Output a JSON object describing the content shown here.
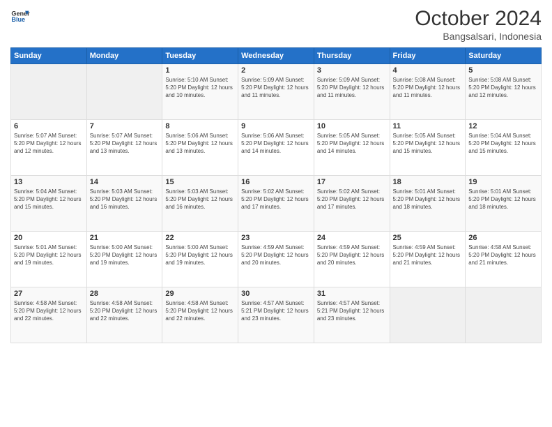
{
  "header": {
    "logo_line1": "General",
    "logo_line2": "Blue",
    "month": "October 2024",
    "location": "Bangsalsari, Indonesia"
  },
  "days_of_week": [
    "Sunday",
    "Monday",
    "Tuesday",
    "Wednesday",
    "Thursday",
    "Friday",
    "Saturday"
  ],
  "weeks": [
    [
      {
        "day": "",
        "info": ""
      },
      {
        "day": "",
        "info": ""
      },
      {
        "day": "1",
        "info": "Sunrise: 5:10 AM\nSunset: 5:20 PM\nDaylight: 12 hours\nand 10 minutes."
      },
      {
        "day": "2",
        "info": "Sunrise: 5:09 AM\nSunset: 5:20 PM\nDaylight: 12 hours\nand 11 minutes."
      },
      {
        "day": "3",
        "info": "Sunrise: 5:09 AM\nSunset: 5:20 PM\nDaylight: 12 hours\nand 11 minutes."
      },
      {
        "day": "4",
        "info": "Sunrise: 5:08 AM\nSunset: 5:20 PM\nDaylight: 12 hours\nand 11 minutes."
      },
      {
        "day": "5",
        "info": "Sunrise: 5:08 AM\nSunset: 5:20 PM\nDaylight: 12 hours\nand 12 minutes."
      }
    ],
    [
      {
        "day": "6",
        "info": "Sunrise: 5:07 AM\nSunset: 5:20 PM\nDaylight: 12 hours\nand 12 minutes."
      },
      {
        "day": "7",
        "info": "Sunrise: 5:07 AM\nSunset: 5:20 PM\nDaylight: 12 hours\nand 13 minutes."
      },
      {
        "day": "8",
        "info": "Sunrise: 5:06 AM\nSunset: 5:20 PM\nDaylight: 12 hours\nand 13 minutes."
      },
      {
        "day": "9",
        "info": "Sunrise: 5:06 AM\nSunset: 5:20 PM\nDaylight: 12 hours\nand 14 minutes."
      },
      {
        "day": "10",
        "info": "Sunrise: 5:05 AM\nSunset: 5:20 PM\nDaylight: 12 hours\nand 14 minutes."
      },
      {
        "day": "11",
        "info": "Sunrise: 5:05 AM\nSunset: 5:20 PM\nDaylight: 12 hours\nand 15 minutes."
      },
      {
        "day": "12",
        "info": "Sunrise: 5:04 AM\nSunset: 5:20 PM\nDaylight: 12 hours\nand 15 minutes."
      }
    ],
    [
      {
        "day": "13",
        "info": "Sunrise: 5:04 AM\nSunset: 5:20 PM\nDaylight: 12 hours\nand 15 minutes."
      },
      {
        "day": "14",
        "info": "Sunrise: 5:03 AM\nSunset: 5:20 PM\nDaylight: 12 hours\nand 16 minutes."
      },
      {
        "day": "15",
        "info": "Sunrise: 5:03 AM\nSunset: 5:20 PM\nDaylight: 12 hours\nand 16 minutes."
      },
      {
        "day": "16",
        "info": "Sunrise: 5:02 AM\nSunset: 5:20 PM\nDaylight: 12 hours\nand 17 minutes."
      },
      {
        "day": "17",
        "info": "Sunrise: 5:02 AM\nSunset: 5:20 PM\nDaylight: 12 hours\nand 17 minutes."
      },
      {
        "day": "18",
        "info": "Sunrise: 5:01 AM\nSunset: 5:20 PM\nDaylight: 12 hours\nand 18 minutes."
      },
      {
        "day": "19",
        "info": "Sunrise: 5:01 AM\nSunset: 5:20 PM\nDaylight: 12 hours\nand 18 minutes."
      }
    ],
    [
      {
        "day": "20",
        "info": "Sunrise: 5:01 AM\nSunset: 5:20 PM\nDaylight: 12 hours\nand 19 minutes."
      },
      {
        "day": "21",
        "info": "Sunrise: 5:00 AM\nSunset: 5:20 PM\nDaylight: 12 hours\nand 19 minutes."
      },
      {
        "day": "22",
        "info": "Sunrise: 5:00 AM\nSunset: 5:20 PM\nDaylight: 12 hours\nand 19 minutes."
      },
      {
        "day": "23",
        "info": "Sunrise: 4:59 AM\nSunset: 5:20 PM\nDaylight: 12 hours\nand 20 minutes."
      },
      {
        "day": "24",
        "info": "Sunrise: 4:59 AM\nSunset: 5:20 PM\nDaylight: 12 hours\nand 20 minutes."
      },
      {
        "day": "25",
        "info": "Sunrise: 4:59 AM\nSunset: 5:20 PM\nDaylight: 12 hours\nand 21 minutes."
      },
      {
        "day": "26",
        "info": "Sunrise: 4:58 AM\nSunset: 5:20 PM\nDaylight: 12 hours\nand 21 minutes."
      }
    ],
    [
      {
        "day": "27",
        "info": "Sunrise: 4:58 AM\nSunset: 5:20 PM\nDaylight: 12 hours\nand 22 minutes."
      },
      {
        "day": "28",
        "info": "Sunrise: 4:58 AM\nSunset: 5:20 PM\nDaylight: 12 hours\nand 22 minutes."
      },
      {
        "day": "29",
        "info": "Sunrise: 4:58 AM\nSunset: 5:20 PM\nDaylight: 12 hours\nand 22 minutes."
      },
      {
        "day": "30",
        "info": "Sunrise: 4:57 AM\nSunset: 5:21 PM\nDaylight: 12 hours\nand 23 minutes."
      },
      {
        "day": "31",
        "info": "Sunrise: 4:57 AM\nSunset: 5:21 PM\nDaylight: 12 hours\nand 23 minutes."
      },
      {
        "day": "",
        "info": ""
      },
      {
        "day": "",
        "info": ""
      }
    ]
  ]
}
